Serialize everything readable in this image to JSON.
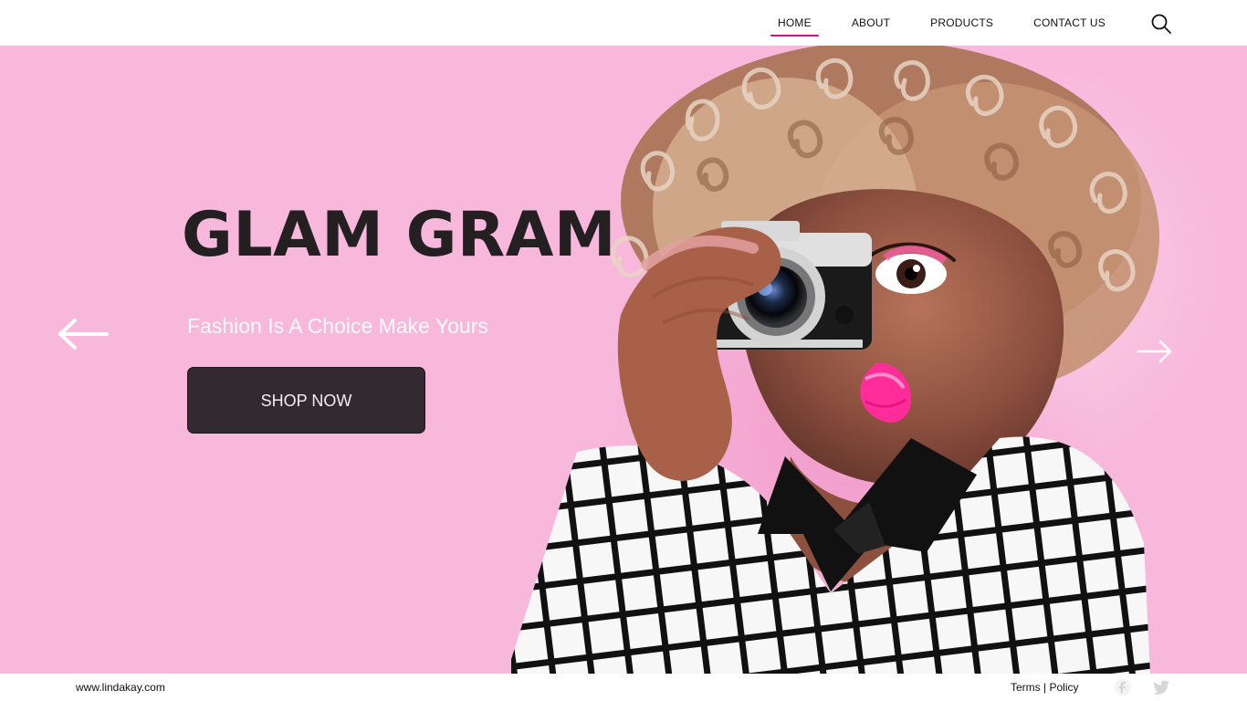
{
  "header": {
    "nav": [
      {
        "label": "HOME",
        "active": true
      },
      {
        "label": "ABOUT",
        "active": false
      },
      {
        "label": "PRODUCTS",
        "active": false
      },
      {
        "label": "CONTACT US",
        "active": false
      }
    ],
    "search_icon": "search-icon"
  },
  "hero": {
    "title": "GLAM GRAM",
    "subtitle": "Fashion Is A Choice Make Yours",
    "cta": "SHOP NOW",
    "left_arrow_icon": "arrow-left-icon",
    "right_arrow_icon": "arrow-right-icon"
  },
  "footer": {
    "website": "www.lindakay.com",
    "terms": "Terms",
    "separator": " | ",
    "policy": "Policy",
    "social_icons": [
      "facebook-icon",
      "twitter-icon"
    ]
  },
  "colors": {
    "hero_background": "#f8b8dc",
    "accent": "#d1127f",
    "button_background": "#332930",
    "title": "#242021"
  }
}
